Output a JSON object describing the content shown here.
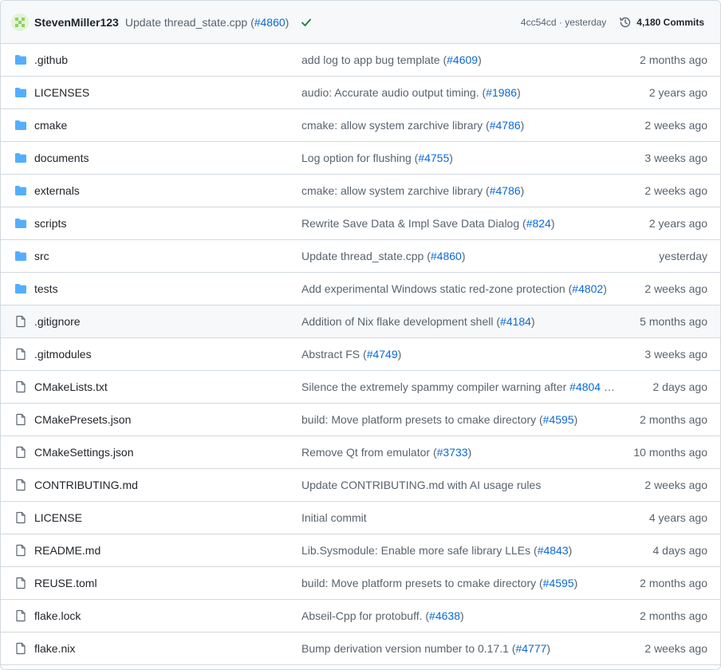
{
  "header": {
    "author": "StevenMiller123",
    "message_prefix": "Update thread_state.cpp (",
    "message_pr": "#4860",
    "message_suffix": ")",
    "status": "check-icon",
    "sha_time": "4cc54cd · yesterday",
    "commits_label": "4,180 Commits"
  },
  "colors": {
    "folder": "#54aeff",
    "link": "#0969da",
    "muted": "#59636e",
    "success": "#1a7f37"
  },
  "rows": [
    {
      "type": "folder",
      "name": ".github",
      "msg": "add log to app bug template (",
      "pr": "#4609",
      "suffix": ")",
      "age": "2 months ago"
    },
    {
      "type": "folder",
      "name": "LICENSES",
      "msg": "audio: Accurate audio output timing. (",
      "pr": "#1986",
      "suffix": ")",
      "age": "2 years ago"
    },
    {
      "type": "folder",
      "name": "cmake",
      "msg": "cmake: allow system zarchive library (",
      "pr": "#4786",
      "suffix": ")",
      "age": "2 weeks ago"
    },
    {
      "type": "folder",
      "name": "documents",
      "msg": "Log option for flushing (",
      "pr": "#4755",
      "suffix": ")",
      "age": "3 weeks ago"
    },
    {
      "type": "folder",
      "name": "externals",
      "msg": "cmake: allow system zarchive library (",
      "pr": "#4786",
      "suffix": ")",
      "age": "2 weeks ago"
    },
    {
      "type": "folder",
      "name": "scripts",
      "msg": "Rewrite Save Data & Impl Save Data Dialog (",
      "pr": "#824",
      "suffix": ")",
      "age": "2 years ago"
    },
    {
      "type": "folder",
      "name": "src",
      "msg": "Update thread_state.cpp (",
      "pr": "#4860",
      "suffix": ")",
      "age": "yesterday"
    },
    {
      "type": "folder",
      "name": "tests",
      "msg": "Add experimental Windows static red-zone protection (",
      "pr": "#4802",
      "suffix": ")",
      "age": "2 weeks ago"
    },
    {
      "type": "file",
      "name": ".gitignore",
      "msg": "Addition of Nix flake development shell (",
      "pr": "#4184",
      "suffix": ")",
      "age": "5 months ago",
      "hl": true
    },
    {
      "type": "file",
      "name": ".gitmodules",
      "msg": "Abstract FS (",
      "pr": "#4749",
      "suffix": ")",
      "age": "3 weeks ago"
    },
    {
      "type": "file",
      "name": "CMakeLists.txt",
      "msg": "Silence the extremely spammy compiler warning after ",
      "pr": "#4804",
      "suffix": " …",
      "age": "2 days ago"
    },
    {
      "type": "file",
      "name": "CMakePresets.json",
      "msg": "build: Move platform presets to cmake directory (",
      "pr": "#4595",
      "suffix": ")",
      "age": "2 months ago"
    },
    {
      "type": "file",
      "name": "CMakeSettings.json",
      "msg": "Remove Qt from emulator (",
      "pr": "#3733",
      "suffix": ")",
      "age": "10 months ago"
    },
    {
      "type": "file",
      "name": "CONTRIBUTING.md",
      "msg": "Update CONTRIBUTING.md with AI usage rules",
      "pr": "",
      "suffix": "",
      "age": "2 weeks ago"
    },
    {
      "type": "file",
      "name": "LICENSE",
      "msg": "Initial commit",
      "pr": "",
      "suffix": "",
      "age": "4 years ago"
    },
    {
      "type": "file",
      "name": "README.md",
      "msg": "Lib.Sysmodule: Enable more safe library LLEs (",
      "pr": "#4843",
      "suffix": ")",
      "age": "4 days ago"
    },
    {
      "type": "file",
      "name": "REUSE.toml",
      "msg": "build: Move platform presets to cmake directory (",
      "pr": "#4595",
      "suffix": ")",
      "age": "2 months ago"
    },
    {
      "type": "file",
      "name": "flake.lock",
      "msg": "Abseil-Cpp for protobuff. (",
      "pr": "#4638",
      "suffix": ")",
      "age": "2 months ago"
    },
    {
      "type": "file",
      "name": "flake.nix",
      "msg": "Bump derivation version number to 0.17.1 (",
      "pr": "#4777",
      "suffix": ")",
      "age": "2 weeks ago"
    }
  ]
}
